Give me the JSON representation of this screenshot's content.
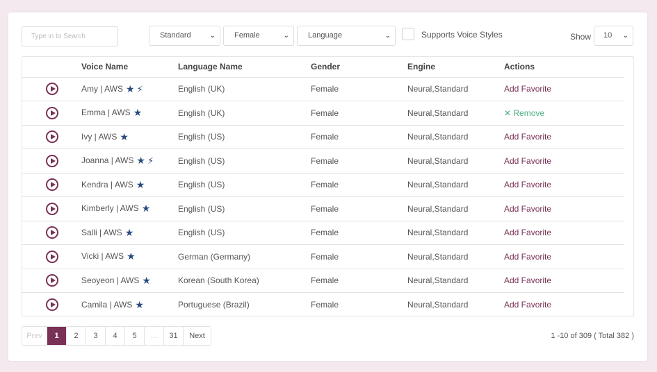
{
  "filters": {
    "search_placeholder": "Type in to Search",
    "engine": "Standard",
    "gender": "Female",
    "language": "Language",
    "voice_styles_label": "Supports Voice Styles",
    "show_label": "Show",
    "page_size": "10"
  },
  "table": {
    "columns": [
      "Voice Name",
      "Language Name",
      "Gender",
      "Engine",
      "Actions"
    ],
    "rows": [
      {
        "voice": "Amy | AWS",
        "star": true,
        "bolt": true,
        "language": "English (UK)",
        "gender": "Female",
        "engine": "Neural,Standard",
        "action": "Add Favorite",
        "action_type": "add"
      },
      {
        "voice": "Emma | AWS",
        "star": true,
        "bolt": false,
        "language": "English (UK)",
        "gender": "Female",
        "engine": "Neural,Standard",
        "action": "✕ Remove",
        "action_type": "remove"
      },
      {
        "voice": "Ivy | AWS",
        "star": true,
        "bolt": false,
        "language": "English (US)",
        "gender": "Female",
        "engine": "Neural,Standard",
        "action": "Add Favorite",
        "action_type": "add"
      },
      {
        "voice": "Joanna | AWS",
        "star": true,
        "bolt": true,
        "language": "English (US)",
        "gender": "Female",
        "engine": "Neural,Standard",
        "action": "Add Favorite",
        "action_type": "add"
      },
      {
        "voice": "Kendra | AWS",
        "star": true,
        "bolt": false,
        "language": "English (US)",
        "gender": "Female",
        "engine": "Neural,Standard",
        "action": "Add Favorite",
        "action_type": "add"
      },
      {
        "voice": "Kimberly | AWS",
        "star": true,
        "bolt": false,
        "language": "English (US)",
        "gender": "Female",
        "engine": "Neural,Standard",
        "action": "Add Favorite",
        "action_type": "add"
      },
      {
        "voice": "Salli | AWS",
        "star": true,
        "bolt": false,
        "language": "English (US)",
        "gender": "Female",
        "engine": "Neural,Standard",
        "action": "Add Favorite",
        "action_type": "add"
      },
      {
        "voice": "Vicki | AWS",
        "star": true,
        "bolt": false,
        "language": "German (Germany)",
        "gender": "Female",
        "engine": "Neural,Standard",
        "action": "Add Favorite",
        "action_type": "add"
      },
      {
        "voice": "Seoyeon | AWS",
        "star": true,
        "bolt": false,
        "language": "Korean (South Korea)",
        "gender": "Female",
        "engine": "Neural,Standard",
        "action": "Add Favorite",
        "action_type": "add"
      },
      {
        "voice": "Camila | AWS",
        "star": true,
        "bolt": false,
        "language": "Portuguese (Brazil)",
        "gender": "Female",
        "engine": "Neural,Standard",
        "action": "Add Favorite",
        "action_type": "add"
      }
    ]
  },
  "pagination": {
    "prev": "Prev",
    "pages": [
      "1",
      "2",
      "3",
      "4",
      "5",
      "...",
      "31"
    ],
    "active": "1",
    "next": "Next",
    "summary": "1 -10 of 309 ( Total 382 )"
  },
  "colors": {
    "accent": "#7a3156",
    "remove": "#4caf7f",
    "icon": "#2a4a7e"
  }
}
